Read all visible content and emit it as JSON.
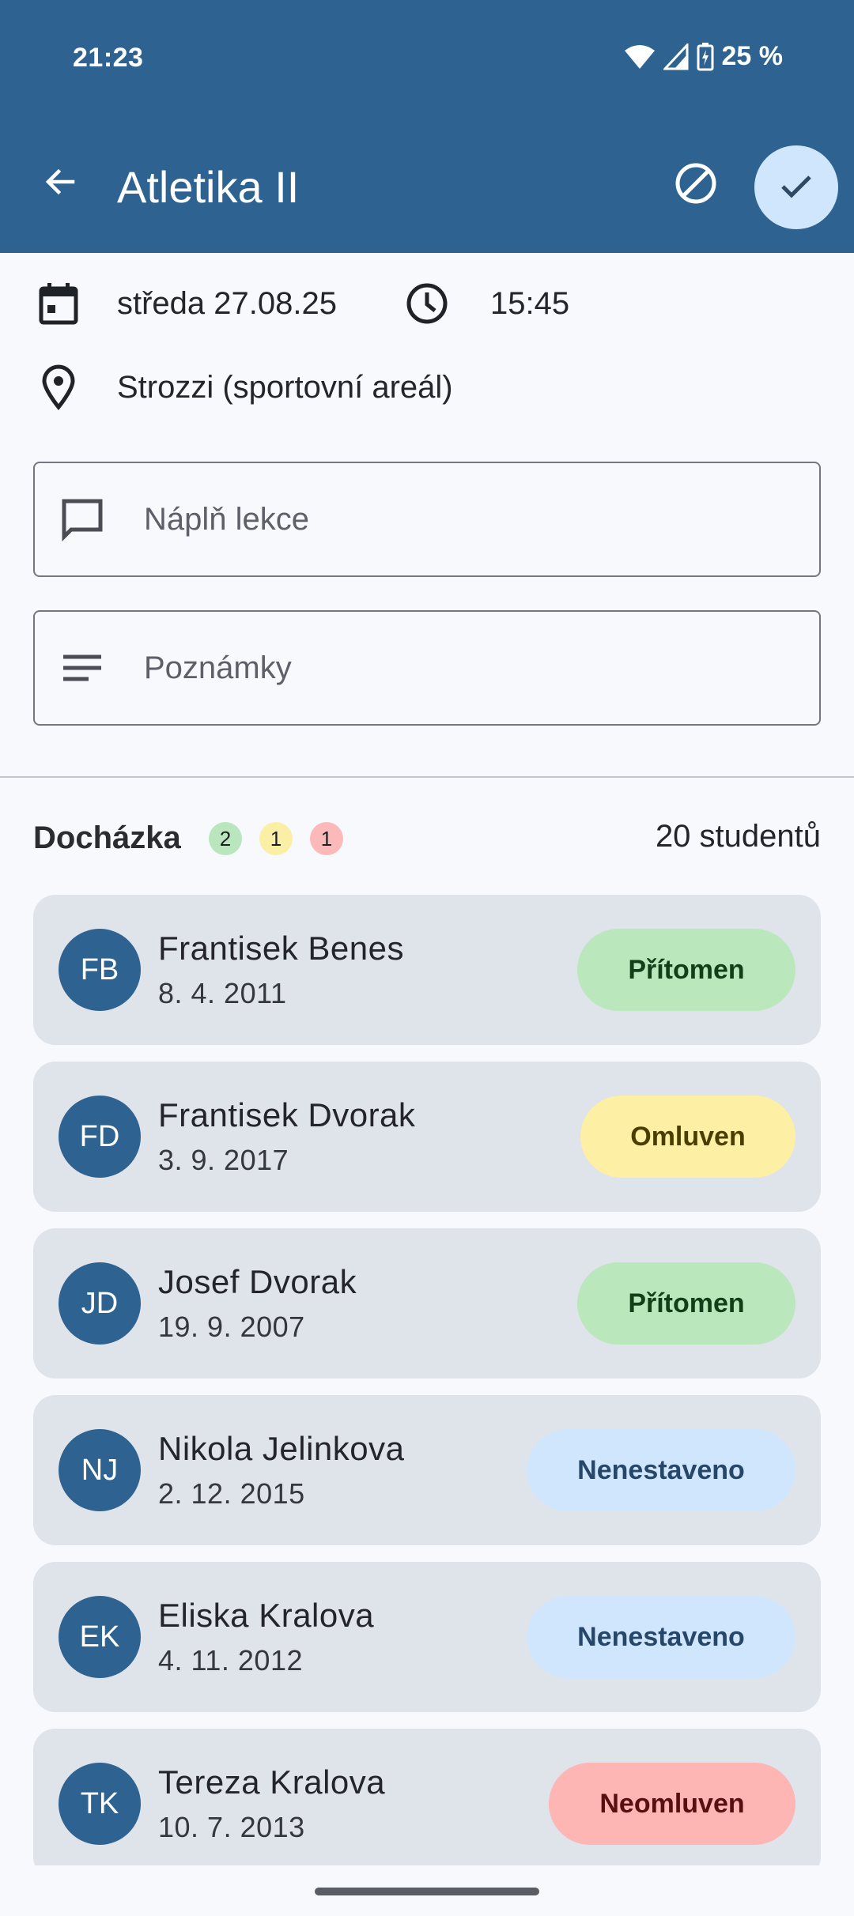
{
  "status_bar": {
    "time": "21:23",
    "battery": "25 %"
  },
  "app_bar": {
    "title": "Atletika II"
  },
  "lesson": {
    "day_date": "středa 27.08.25",
    "time": "15:45",
    "location": "Strozzi (sportovní areál)"
  },
  "fields": {
    "content_placeholder": "Náplň lekce",
    "notes_placeholder": "Poznámky"
  },
  "attendance": {
    "title": "Docházka",
    "badges": [
      {
        "count": "2",
        "color": "#b9e6bd"
      },
      {
        "count": "1",
        "color": "#fbefa6"
      },
      {
        "count": "1",
        "color": "#fcb9b9"
      }
    ],
    "student_count": "20 studentů"
  },
  "statuses": {
    "present": {
      "label": "Přítomen",
      "bg": "#bae7bc",
      "fg": "#113f18"
    },
    "excused": {
      "label": "Omluven",
      "bg": "#fdf0a4",
      "fg": "#4a3d00"
    },
    "unset": {
      "label": "Nenestaveno",
      "bg": "#d0e6fd",
      "fg": "#27476a"
    },
    "unexcused": {
      "label": "Neomluven",
      "bg": "#fdb6b4",
      "fg": "#55100f"
    }
  },
  "students": [
    {
      "initials": "FB",
      "name": "Frantisek Benes",
      "dob": "8. 4. 2011",
      "status": "Přítomen"
    },
    {
      "initials": "FD",
      "name": "Frantisek Dvorak",
      "dob": "3. 9. 2017",
      "status": "Omluven"
    },
    {
      "initials": "JD",
      "name": "Josef Dvorak",
      "dob": "19. 9. 2007",
      "status": "Přítomen"
    },
    {
      "initials": "NJ",
      "name": "Nikola Jelinkova",
      "dob": "2. 12. 2015",
      "status": "Nenestaveno"
    },
    {
      "initials": "EK",
      "name": "Eliska Kralova",
      "dob": "4. 11. 2012",
      "status": "Nenestaveno"
    },
    {
      "initials": "TK",
      "name": "Tereza Kralova",
      "dob": "10. 7. 2013",
      "status": "Neomluven"
    }
  ]
}
